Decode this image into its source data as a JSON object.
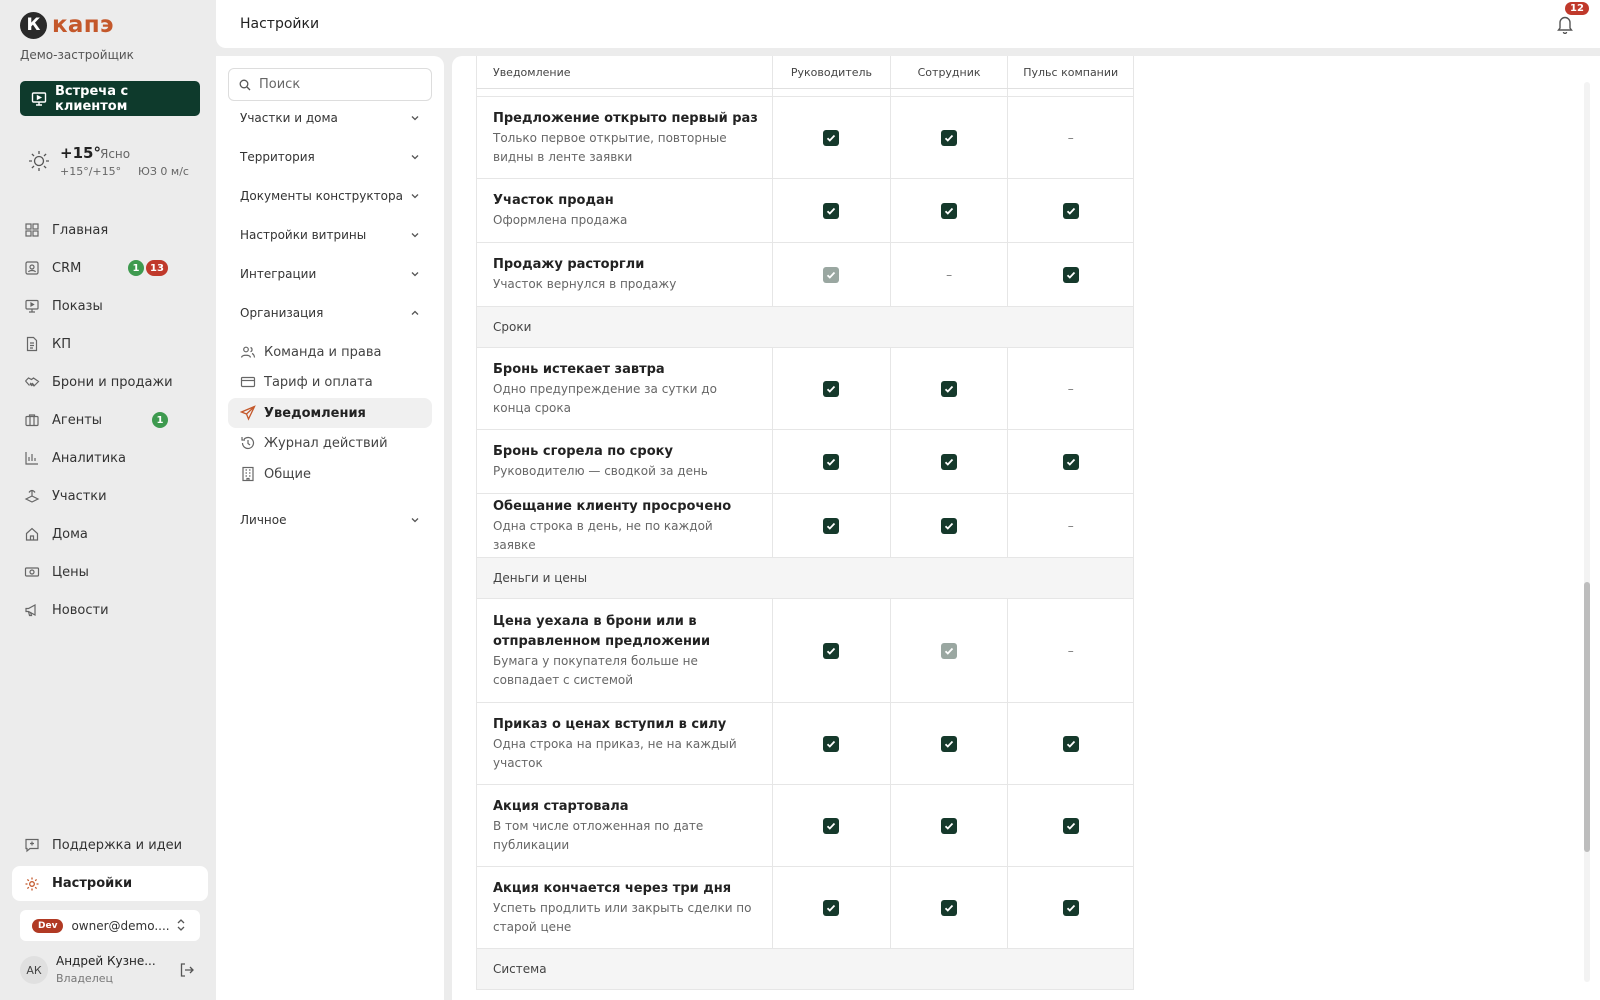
{
  "brand": {
    "mark": "К",
    "name": "капэ",
    "company": "Демо-застройщик",
    "color": "#c4582b"
  },
  "meeting_button": "Встреча с клиентом",
  "weather": {
    "temp": "+15°",
    "condition": "Ясно",
    "range": "+15°/+15°",
    "wind": "ЮЗ 0 м/с"
  },
  "nav": {
    "items": [
      {
        "label": "Главная",
        "icon": "grid-icon"
      },
      {
        "label": "CRM",
        "icon": "crm-icon",
        "badges": [
          "1",
          "13"
        ]
      },
      {
        "label": "Показы",
        "icon": "monitor-icon"
      },
      {
        "label": "КП",
        "icon": "document-icon"
      },
      {
        "label": "Брони и продажи",
        "icon": "handshake-icon"
      },
      {
        "label": "Агенты",
        "icon": "briefcase-icon",
        "badges": [
          "1"
        ]
      },
      {
        "label": "Аналитика",
        "icon": "chart-icon"
      },
      {
        "label": "Участки",
        "icon": "plots-icon"
      },
      {
        "label": "Дома",
        "icon": "house-icon"
      },
      {
        "label": "Цены",
        "icon": "price-icon"
      },
      {
        "label": "Новости",
        "icon": "megaphone-icon"
      }
    ],
    "support": "Поддержка и идеи",
    "settings": "Настройки"
  },
  "account": {
    "env": "Dev",
    "email": "owner@demo....",
    "initials": "АК",
    "name": "Андрей Кузне...",
    "role": "Владелец"
  },
  "header": {
    "title": "Настройки",
    "notifications": "12"
  },
  "settings_menu": {
    "search_placeholder": "Поиск",
    "sections": [
      "Участки и дома",
      "Территория",
      "Документы конструктора",
      "Настройки витрины",
      "Интеграции",
      "Организация",
      "Личное"
    ],
    "org_items": [
      {
        "label": "Команда и права",
        "icon": "team-icon"
      },
      {
        "label": "Тариф и оплата",
        "icon": "card-icon"
      },
      {
        "label": "Уведомления",
        "icon": "send-icon",
        "active": true
      },
      {
        "label": "Журнал действий",
        "icon": "history-icon"
      },
      {
        "label": "Общие",
        "icon": "building-icon"
      }
    ]
  },
  "table": {
    "columns": [
      "Уведомление",
      "Руководитель",
      "Сотрудник",
      "Пульс компании"
    ],
    "groups": [
      {
        "name": "",
        "rows": [
          {
            "title": "Предложение открыто первый раз",
            "desc": "Только первое открытие, повторные видны в ленте заявки",
            "values": [
              "on",
              "on",
              "none"
            ]
          },
          {
            "title": "Участок продан",
            "desc": "Оформлена продажа",
            "values": [
              "on",
              "on",
              "on"
            ]
          },
          {
            "title": "Продажу расторгли",
            "desc": "Участок вернулся в продажу",
            "values": [
              "locked",
              "none",
              "on"
            ]
          }
        ]
      },
      {
        "name": "Сроки",
        "rows": [
          {
            "title": "Бронь истекает завтра",
            "desc": "Одно предупреждение за сутки до конца срока",
            "values": [
              "on",
              "on",
              "none"
            ]
          },
          {
            "title": "Бронь сгорела по сроку",
            "desc": "Руководителю — сводкой за день",
            "values": [
              "on",
              "on",
              "on"
            ]
          },
          {
            "title": "Обещание клиенту просрочено",
            "desc": "Одна строка в день, не по каждой заявке",
            "values": [
              "on",
              "on",
              "none"
            ]
          }
        ]
      },
      {
        "name": "Деньги и цены",
        "rows": [
          {
            "title": "Цена уехала в брони или в отправленном предложении",
            "desc": "Бумага у покупателя больше не совпадает с системой",
            "values": [
              "on",
              "locked",
              "none"
            ]
          },
          {
            "title": "Приказ о ценах вступил в силу",
            "desc": "Одна строка на приказ, не на каждый участок",
            "values": [
              "on",
              "on",
              "on"
            ]
          },
          {
            "title": "Акция стартовала",
            "desc": "В том числе отложенная по дате публикации",
            "values": [
              "on",
              "on",
              "on"
            ]
          },
          {
            "title": "Акция кончается через три дня",
            "desc": "Успеть продлить или закрыть сделки по старой цене",
            "values": [
              "on",
              "on",
              "on"
            ]
          }
        ]
      },
      {
        "name": "Система",
        "rows": []
      }
    ],
    "dash": "–"
  }
}
